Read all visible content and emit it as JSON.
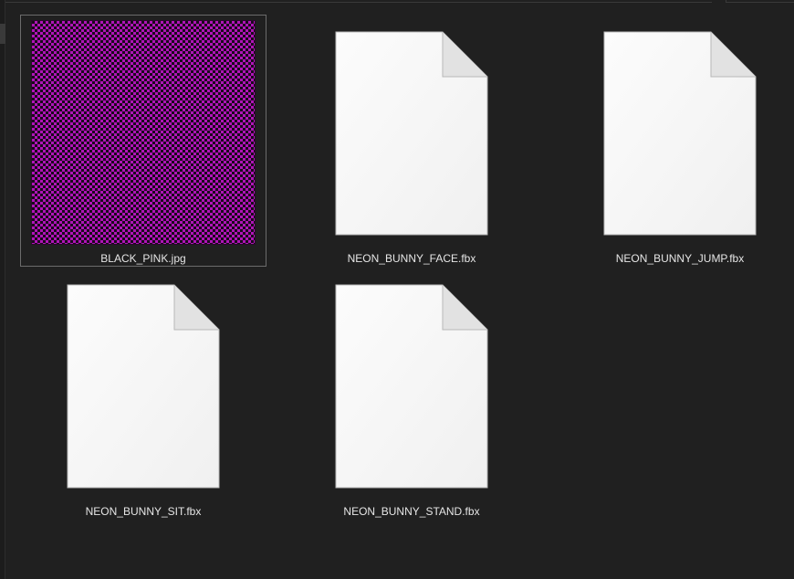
{
  "explorer": {
    "files": [
      {
        "name": "BLACK_PINK.jpg",
        "type": "image",
        "icon": "checker-image-thumbnail",
        "selected": true,
        "colors": {
          "a": "#b014b8",
          "b": "#1a0a1c"
        }
      },
      {
        "name": "NEON_BUNNY_FACE.fbx",
        "type": "document",
        "icon": "blank-file-icon",
        "selected": false
      },
      {
        "name": "NEON_BUNNY_JUMP.fbx",
        "type": "document",
        "icon": "blank-file-icon",
        "selected": false
      },
      {
        "name": "NEON_BUNNY_SIT.fbx",
        "type": "document",
        "icon": "blank-file-icon",
        "selected": false
      },
      {
        "name": "NEON_BUNNY_STAND.fbx",
        "type": "document",
        "icon": "blank-file-icon",
        "selected": false
      }
    ],
    "colors": {
      "background": "#202020",
      "text": "#e6e6e6",
      "selection_border": "#6b6b6b"
    }
  }
}
